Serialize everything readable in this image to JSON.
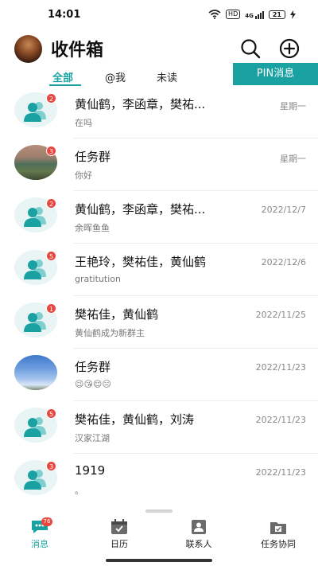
{
  "status_bar": {
    "time": "14:01",
    "hd_label": "HD",
    "network_label": "4G",
    "battery_level": "21"
  },
  "header": {
    "title": "收件箱",
    "icons": {
      "search": "search-icon",
      "add": "plus-circle-icon"
    }
  },
  "tabs": [
    {
      "label": "全部",
      "active": true
    },
    {
      "label": "@我",
      "active": false
    },
    {
      "label": "未读",
      "active": false
    }
  ],
  "pin_button": {
    "label": "PIN消息"
  },
  "chats": [
    {
      "name": "黄仙鹤，李函章，樊祐...",
      "preview": "在吗",
      "date": "星期一",
      "badge": "2",
      "avatar": "group-icon"
    },
    {
      "name": "任务群",
      "preview": "你好",
      "date": "星期一",
      "badge": "3",
      "avatar": "landscape-photo"
    },
    {
      "name": "黄仙鹤，李函章，樊祐...",
      "preview": "余晖鱼鱼",
      "date": "2022/12/7",
      "badge": "2",
      "avatar": "group-icon"
    },
    {
      "name": "王艳玲，樊祐佳，黄仙鹤",
      "preview": "gratitution",
      "date": "2022/12/6",
      "badge": "5",
      "avatar": "group-icon"
    },
    {
      "name": "樊祐佳，黄仙鹤",
      "preview": "黄仙鹤成为新群主",
      "date": "2022/11/25",
      "badge": "1",
      "avatar": "group-icon"
    },
    {
      "name": "任务群",
      "preview": "😉😘😌😑",
      "date": "2022/11/23",
      "badge": "",
      "avatar": "sky-photo"
    },
    {
      "name": "樊祐佳，黄仙鹤，刘涛",
      "preview": "汉家江湖",
      "date": "2022/11/23",
      "badge": "5",
      "avatar": "group-icon"
    },
    {
      "name": "1919",
      "preview": "。",
      "date": "2022/11/23",
      "badge": "3",
      "avatar": "group-icon"
    }
  ],
  "bottom_nav": [
    {
      "label": "消息",
      "icon": "chat-bubble-icon",
      "active": true,
      "badge": "76"
    },
    {
      "label": "日历",
      "icon": "calendar-icon",
      "active": false,
      "badge": ""
    },
    {
      "label": "联系人",
      "icon": "contacts-icon",
      "active": false,
      "badge": ""
    },
    {
      "label": "任务协同",
      "icon": "task-folder-icon",
      "active": false,
      "badge": ""
    }
  ],
  "colors": {
    "accent": "#1aa2a3",
    "badge": "#e8463e"
  }
}
